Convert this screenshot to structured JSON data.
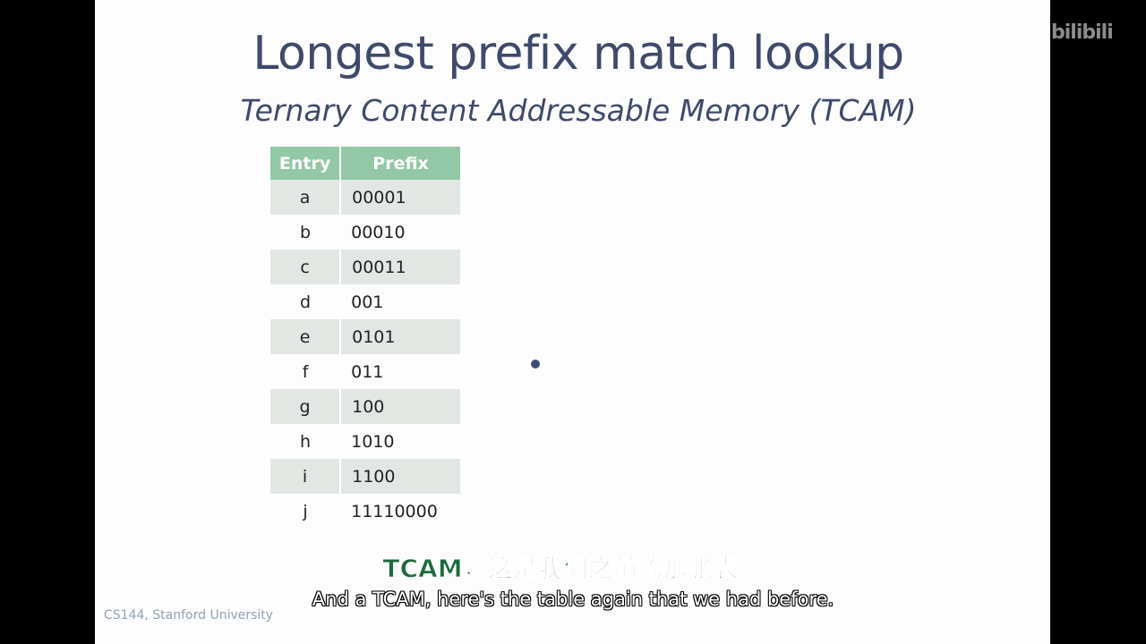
{
  "slide": {
    "title": "Longest prefix match lookup",
    "subtitle": "Ternary Content Addressable Memory (TCAM)",
    "footer": "CS144, Stanford University"
  },
  "table": {
    "headers": [
      "Entry",
      "Prefix"
    ],
    "rows": [
      {
        "entry": "a",
        "prefix": "00001"
      },
      {
        "entry": "b",
        "prefix": "00010"
      },
      {
        "entry": "c",
        "prefix": "00011"
      },
      {
        "entry": "d",
        "prefix": "001"
      },
      {
        "entry": "e",
        "prefix": "0101"
      },
      {
        "entry": "f",
        "prefix": "011"
      },
      {
        "entry": "g",
        "prefix": "100"
      },
      {
        "entry": "h",
        "prefix": "1010"
      },
      {
        "entry": "i",
        "prefix": "1100"
      },
      {
        "entry": "j",
        "prefix": "11110000"
      }
    ]
  },
  "subtitles": {
    "chinese": "TCAM，这是我们之前的那张表。",
    "english": "And a TCAM, here's the table again that we had before."
  },
  "watermark": "bilibili",
  "colors": {
    "title": "#3f4a6b",
    "table_header": "#93c8a6",
    "row_shade": "#e3e7e4",
    "subtitle_cn": "#1b6b3c"
  }
}
